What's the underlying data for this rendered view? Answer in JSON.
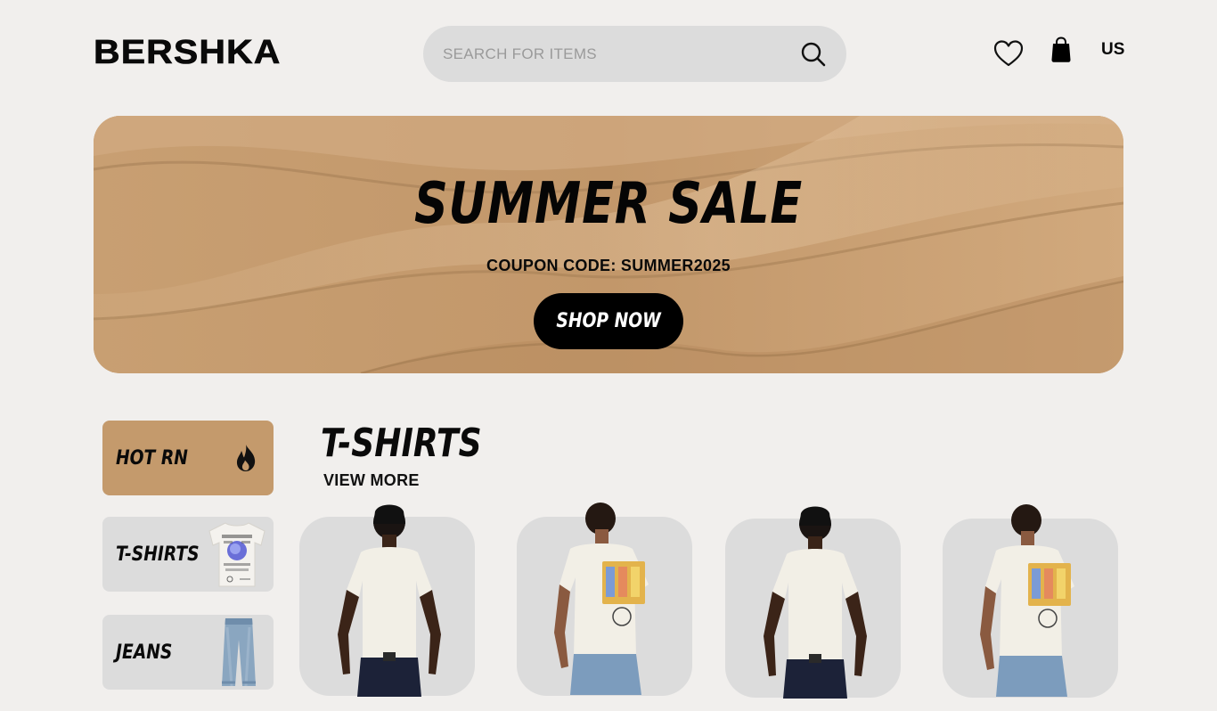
{
  "header": {
    "logo": "BERSHKA",
    "search_placeholder": "SEARCH FOR ITEMS",
    "region": "US",
    "icons": [
      "search-icon",
      "heart-icon",
      "shopping-bag-icon"
    ]
  },
  "banner": {
    "title": "SUMMER SALE",
    "coupon": "COUPON CODE: SUMMER2025",
    "cta": "SHOP NOW",
    "colors": {
      "banner": "#c49a6c",
      "button": "#000000"
    }
  },
  "sidebar": {
    "items": [
      {
        "label": "HOT RN",
        "icon": "fire-icon",
        "active": true
      },
      {
        "label": "T-SHIRTS",
        "icon": "tshirt-thumbnail"
      },
      {
        "label": "JEANS",
        "icon": "jeans-thumbnail"
      }
    ]
  },
  "section": {
    "title": "T-SHIRTS",
    "view_more": "VIEW MORE",
    "products": [
      {
        "view": "front",
        "image": "model-front-white-tee"
      },
      {
        "view": "back",
        "image": "model-back-printed-tee"
      },
      {
        "view": "front",
        "image": "model-front-white-tee"
      },
      {
        "view": "back",
        "image": "model-back-printed-tee"
      }
    ]
  },
  "colors": {
    "background": "#f1efed",
    "card": "#dcdcdc",
    "accent": "#c49a6c"
  }
}
